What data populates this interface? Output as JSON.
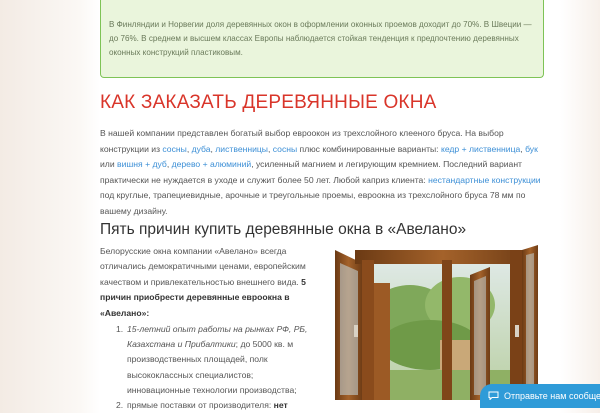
{
  "notice": {
    "text": "В Финляндии и Норвегии доля деревянных окон в оформлении оконных проемов доходит до 70%. В Швеции — до 76%. В среднем и высшем классах Европы наблюдается стойкая тенденция к предпочтению деревянных оконных конструкций пластиковым."
  },
  "order_section": {
    "title": "КАК ЗАКАЗАТЬ ДЕРЕВЯННЫЕ ОКНА",
    "p_intro": "В нашей компании представлен богатый выбор евроокон из трехслойного клееного бруса. На выбор конструкции из ",
    "link_pine": "сосны",
    "link_oak": "дуба",
    "link_larch": "лиственницы",
    "link_pine2": "сосны",
    "p_combined": " плюс комбинированные варианты: ",
    "link_cedar_larch": "кедр + лиственница",
    "sep1": ", ",
    "link_beech": "бук",
    "or_word": " или ",
    "link_cherry_oak": "вишня + дуб",
    "link_wood_alu": "дерево + алюминий",
    "p_middle": ", усиленный магнием и легирующим кремнием. Последний вариант практически не нуждается в уходе и служит более 50 лет. Любой каприз клиента: ",
    "link_nonstandard": "нестандартные конструкции",
    "p_end": " под круглые, трапециевидные, арочные и треугольные проемы, евроокна из трехслойного бруса 78 мм по вашему дизайну."
  },
  "reasons_section": {
    "title": "Пять причин купить деревянные окна в «Авелано»",
    "intro": "Белорусские окна компании «Авелано» всегда отличались демократичными ценами, европейским качеством и привлекательностью внешнего вида. ",
    "intro_bold": "5 причин приобрести деревянные евроокна в «Авелано»",
    "intro_colon": ":",
    "items": [
      {
        "num": "1.",
        "italic": "15-летний опыт работы на рынках РФ, РБ, Казахстана и Прибалтики",
        "text": "; до 5000 кв. м производственных площадей, полк высококлассных специалистов; инновационные технологии производства;"
      },
      {
        "num": "2.",
        "text": "прямые поставки от производителя: ",
        "bold": "нет"
      }
    ]
  },
  "photo": {
    "icon": "window-photo"
  },
  "chat": {
    "label": "Отправьте нам сообщение",
    "icon": "chat-icon"
  },
  "colors": {
    "accent_red": "#d9352a",
    "link_blue": "#3c8fd6",
    "notice_green": "#7ec356",
    "chat_blue": "#2f9bd8"
  }
}
